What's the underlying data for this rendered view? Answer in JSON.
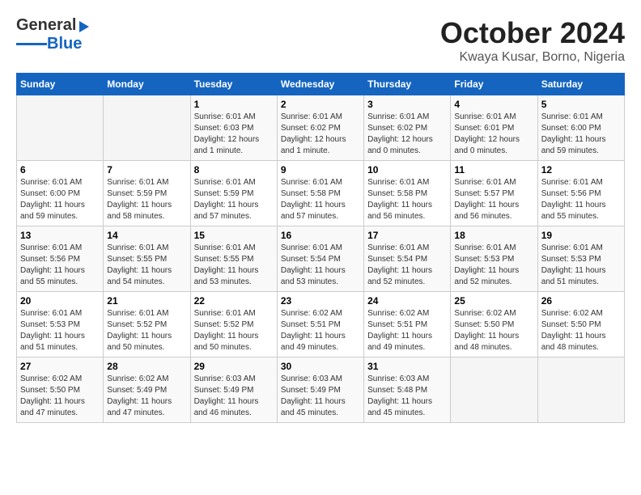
{
  "header": {
    "logo_general": "General",
    "logo_blue": "Blue",
    "title": "October 2024",
    "subtitle": "Kwaya Kusar, Borno, Nigeria"
  },
  "days_of_week": [
    "Sunday",
    "Monday",
    "Tuesday",
    "Wednesday",
    "Thursday",
    "Friday",
    "Saturday"
  ],
  "weeks": [
    [
      {
        "day": "",
        "info": ""
      },
      {
        "day": "",
        "info": ""
      },
      {
        "day": "1",
        "info": "Sunrise: 6:01 AM\nSunset: 6:03 PM\nDaylight: 12 hours\nand 1 minute."
      },
      {
        "day": "2",
        "info": "Sunrise: 6:01 AM\nSunset: 6:02 PM\nDaylight: 12 hours\nand 1 minute."
      },
      {
        "day": "3",
        "info": "Sunrise: 6:01 AM\nSunset: 6:02 PM\nDaylight: 12 hours\nand 0 minutes."
      },
      {
        "day": "4",
        "info": "Sunrise: 6:01 AM\nSunset: 6:01 PM\nDaylight: 12 hours\nand 0 minutes."
      },
      {
        "day": "5",
        "info": "Sunrise: 6:01 AM\nSunset: 6:00 PM\nDaylight: 11 hours\nand 59 minutes."
      }
    ],
    [
      {
        "day": "6",
        "info": "Sunrise: 6:01 AM\nSunset: 6:00 PM\nDaylight: 11 hours\nand 59 minutes."
      },
      {
        "day": "7",
        "info": "Sunrise: 6:01 AM\nSunset: 5:59 PM\nDaylight: 11 hours\nand 58 minutes."
      },
      {
        "day": "8",
        "info": "Sunrise: 6:01 AM\nSunset: 5:59 PM\nDaylight: 11 hours\nand 57 minutes."
      },
      {
        "day": "9",
        "info": "Sunrise: 6:01 AM\nSunset: 5:58 PM\nDaylight: 11 hours\nand 57 minutes."
      },
      {
        "day": "10",
        "info": "Sunrise: 6:01 AM\nSunset: 5:58 PM\nDaylight: 11 hours\nand 56 minutes."
      },
      {
        "day": "11",
        "info": "Sunrise: 6:01 AM\nSunset: 5:57 PM\nDaylight: 11 hours\nand 56 minutes."
      },
      {
        "day": "12",
        "info": "Sunrise: 6:01 AM\nSunset: 5:56 PM\nDaylight: 11 hours\nand 55 minutes."
      }
    ],
    [
      {
        "day": "13",
        "info": "Sunrise: 6:01 AM\nSunset: 5:56 PM\nDaylight: 11 hours\nand 55 minutes."
      },
      {
        "day": "14",
        "info": "Sunrise: 6:01 AM\nSunset: 5:55 PM\nDaylight: 11 hours\nand 54 minutes."
      },
      {
        "day": "15",
        "info": "Sunrise: 6:01 AM\nSunset: 5:55 PM\nDaylight: 11 hours\nand 53 minutes."
      },
      {
        "day": "16",
        "info": "Sunrise: 6:01 AM\nSunset: 5:54 PM\nDaylight: 11 hours\nand 53 minutes."
      },
      {
        "day": "17",
        "info": "Sunrise: 6:01 AM\nSunset: 5:54 PM\nDaylight: 11 hours\nand 52 minutes."
      },
      {
        "day": "18",
        "info": "Sunrise: 6:01 AM\nSunset: 5:53 PM\nDaylight: 11 hours\nand 52 minutes."
      },
      {
        "day": "19",
        "info": "Sunrise: 6:01 AM\nSunset: 5:53 PM\nDaylight: 11 hours\nand 51 minutes."
      }
    ],
    [
      {
        "day": "20",
        "info": "Sunrise: 6:01 AM\nSunset: 5:53 PM\nDaylight: 11 hours\nand 51 minutes."
      },
      {
        "day": "21",
        "info": "Sunrise: 6:01 AM\nSunset: 5:52 PM\nDaylight: 11 hours\nand 50 minutes."
      },
      {
        "day": "22",
        "info": "Sunrise: 6:01 AM\nSunset: 5:52 PM\nDaylight: 11 hours\nand 50 minutes."
      },
      {
        "day": "23",
        "info": "Sunrise: 6:02 AM\nSunset: 5:51 PM\nDaylight: 11 hours\nand 49 minutes."
      },
      {
        "day": "24",
        "info": "Sunrise: 6:02 AM\nSunset: 5:51 PM\nDaylight: 11 hours\nand 49 minutes."
      },
      {
        "day": "25",
        "info": "Sunrise: 6:02 AM\nSunset: 5:50 PM\nDaylight: 11 hours\nand 48 minutes."
      },
      {
        "day": "26",
        "info": "Sunrise: 6:02 AM\nSunset: 5:50 PM\nDaylight: 11 hours\nand 48 minutes."
      }
    ],
    [
      {
        "day": "27",
        "info": "Sunrise: 6:02 AM\nSunset: 5:50 PM\nDaylight: 11 hours\nand 47 minutes."
      },
      {
        "day": "28",
        "info": "Sunrise: 6:02 AM\nSunset: 5:49 PM\nDaylight: 11 hours\nand 47 minutes."
      },
      {
        "day": "29",
        "info": "Sunrise: 6:03 AM\nSunset: 5:49 PM\nDaylight: 11 hours\nand 46 minutes."
      },
      {
        "day": "30",
        "info": "Sunrise: 6:03 AM\nSunset: 5:49 PM\nDaylight: 11 hours\nand 45 minutes."
      },
      {
        "day": "31",
        "info": "Sunrise: 6:03 AM\nSunset: 5:48 PM\nDaylight: 11 hours\nand 45 minutes."
      },
      {
        "day": "",
        "info": ""
      },
      {
        "day": "",
        "info": ""
      }
    ]
  ]
}
